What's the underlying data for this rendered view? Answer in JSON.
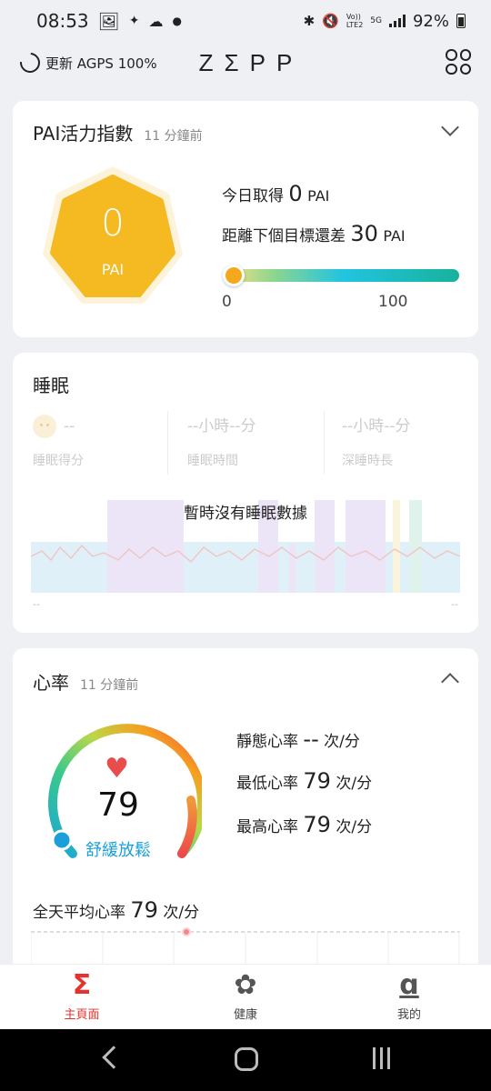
{
  "status_bar": {
    "time": "08:53",
    "battery": "92%",
    "network_voice": "Vo))\nLTE2",
    "network_gen": "5G"
  },
  "header": {
    "sync_text": "更新 AGPS 100%",
    "logo": "ZΣPP",
    "menu_icon": "grid-icon"
  },
  "pai": {
    "title": "PAI活力指數",
    "updated": "11 分鐘前",
    "value": "0",
    "unit": "PAI",
    "today_label": "今日取得",
    "today_value": "0",
    "today_unit": "PAI",
    "remain_label": "距離下個目標還差",
    "remain_value": "30",
    "remain_unit": "PAI",
    "progress_min": "0",
    "progress_max": "100",
    "progress_value": 0,
    "badge_color": "#f5b921"
  },
  "sleep": {
    "title": "睡眠",
    "score_value": "--",
    "score_label": "睡眠得分",
    "time_value": "--小時--分",
    "time_label": "睡眠時間",
    "deep_value": "--小時--分",
    "deep_label": "深睡時長",
    "empty_text": "暫時沒有睡眠數據",
    "chart_left": "--",
    "chart_right": "--"
  },
  "heart_rate": {
    "title": "心率",
    "updated": "11 分鐘前",
    "value": "79",
    "zone": "舒緩放鬆",
    "resting_label": "靜態心率",
    "resting_value": "--",
    "resting_unit": "次/分",
    "min_label": "最低心率",
    "min_value": "79",
    "min_unit": "次/分",
    "max_label": "最高心率",
    "max_value": "79",
    "max_unit": "次/分",
    "avg_label": "全天平均心率",
    "avg_value": "79",
    "avg_unit": "次/分",
    "accent_color": "#1a9fd8"
  },
  "bottom_nav": [
    {
      "label": "主頁面",
      "icon": "sigma-icon",
      "glyph": "Σ",
      "active": true
    },
    {
      "label": "健康",
      "icon": "health-icon",
      "glyph": "✿",
      "active": false
    },
    {
      "label": "我的",
      "icon": "profile-icon",
      "glyph": "ɑ",
      "active": false
    }
  ]
}
